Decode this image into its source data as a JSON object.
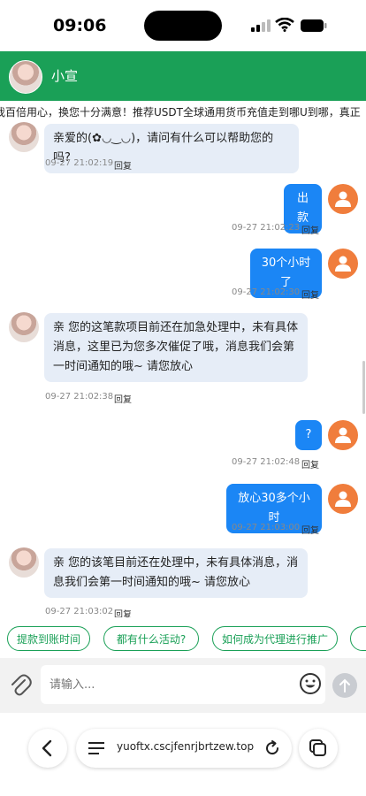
{
  "status": {
    "time": "09:06"
  },
  "header": {
    "title": "小宣"
  },
  "notice": "我百倍用心，换您十分满意！推荐USDT全球通用货币充值走到哪U到哪，真正",
  "messages": [
    {
      "from": "bot",
      "text": "亲爱的(✿◡‿◡)，请问有什么可以帮助您的吗?",
      "time": "09-27 21:02:19",
      "action": "回复"
    },
    {
      "from": "user",
      "text": "出款",
      "time": "09-27 21:02:23",
      "action": "回复"
    },
    {
      "from": "user",
      "text": "30个小时了",
      "time": "09-27 21:02:30",
      "action": "回复"
    },
    {
      "from": "bot",
      "text": "亲 您的这笔款项目前还在加急处理中，未有具体消息，这里已为您多次催促了哦，消息我们会第一时间通知的哦~ 请您放心",
      "time": "09-27 21:02:38",
      "action": "回复"
    },
    {
      "from": "user",
      "text": "?",
      "time": "09-27 21:02:48",
      "action": "回复"
    },
    {
      "from": "user",
      "text": "放心30多个小时",
      "time": "09-27 21:03:00",
      "action": "回复"
    },
    {
      "from": "bot",
      "text": "亲 您的该笔目前还在处理中，未有具体消息，消息我们会第一时间通知的哦~ 请您放心",
      "time": "09-27 21:03:02",
      "action": "回复"
    }
  ],
  "quick_replies": [
    "提款到账时间",
    "都有什么活动?",
    "如何成为代理进行推广"
  ],
  "composer": {
    "placeholder": "请输入..."
  },
  "browser": {
    "url": "yuoftx.cscjfenrjbrtzew.top"
  },
  "colors": {
    "header": "#1aa057",
    "user_bubble": "#1b86f5",
    "bot_bubble": "#e6edf7",
    "user_avatar": "#f07d3c"
  },
  "icons": [
    "signal-icon",
    "wifi-icon",
    "battery-icon",
    "user-icon",
    "paperclip-icon",
    "emoji-icon",
    "send-icon",
    "back-icon",
    "menu-icon",
    "reload-icon",
    "tabs-icon"
  ]
}
